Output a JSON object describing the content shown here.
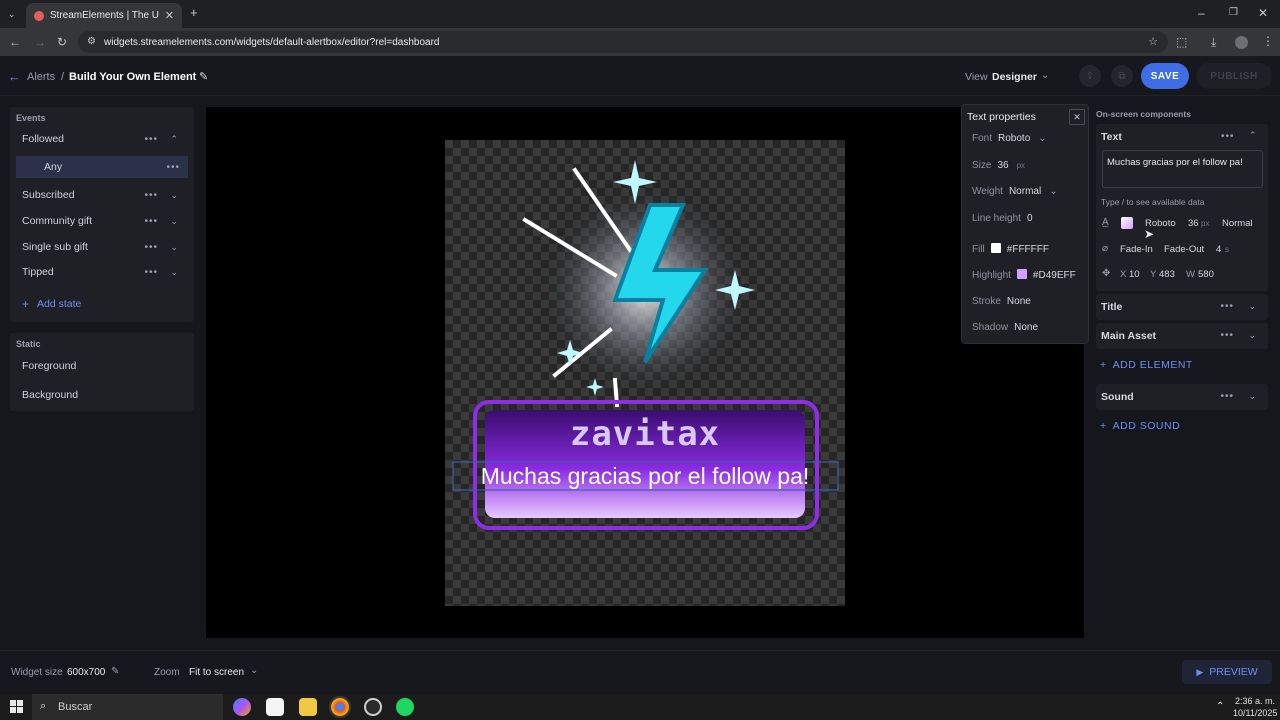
{
  "browser": {
    "tab_title": "StreamElements | The Ultimate",
    "url": "widgets.streamelements.com/widgets/default-alertbox/editor?rel=dashboard"
  },
  "header": {
    "breadcrumb_root": "Alerts",
    "breadcrumb_sep": "/",
    "page_title": "Build Your Own Element",
    "view_label": "View",
    "view_value": "Designer",
    "save_label": "SAVE",
    "publish_label": "PUBLISH"
  },
  "events": {
    "section_title": "Events",
    "items": [
      {
        "label": "Followed"
      },
      {
        "label": "Any"
      },
      {
        "label": "Subscribed"
      },
      {
        "label": "Community gift"
      },
      {
        "label": "Single sub gift"
      },
      {
        "label": "Tipped"
      }
    ],
    "add_state": "Add state"
  },
  "static": {
    "section_title": "Static",
    "items": [
      {
        "label": "Foreground"
      },
      {
        "label": "Background"
      }
    ]
  },
  "canvas": {
    "username": "zavitax",
    "message": "Muchas gracias por el follow pa!"
  },
  "text_properties": {
    "title": "Text properties",
    "font_label": "Font",
    "font_value": "Roboto",
    "size_label": "Size",
    "size_value": "36",
    "size_unit": "px",
    "weight_label": "Weight",
    "weight_value": "Normal",
    "lineheight_label": "Line height",
    "lineheight_value": "0",
    "fill_label": "Fill",
    "fill_value": "#FFFFFF",
    "highlight_label": "Highlight",
    "highlight_value": "#D49EFF",
    "stroke_label": "Stroke",
    "stroke_value": "None",
    "shadow_label": "Shadow",
    "shadow_value": "None"
  },
  "components": {
    "section_title": "On-screen components",
    "text": {
      "label": "Text",
      "value": "Muchas gracias por el follow pa!",
      "hint": "Type / to see available data",
      "font": "Roboto",
      "size": "36",
      "size_unit": "px",
      "weight": "Normal",
      "anim_in": "Fade-In",
      "anim_out": "Fade-Out",
      "duration": "4",
      "duration_unit": "s",
      "x_label": "X",
      "x": "10",
      "y_label": "Y",
      "y": "483",
      "w_label": "W",
      "w": "580"
    },
    "title_label": "Title",
    "main_asset_label": "Main Asset",
    "add_element": "ADD ELEMENT",
    "sound_label": "Sound",
    "add_sound": "ADD SOUND"
  },
  "footer": {
    "widget_size_label": "Widget size",
    "widget_size_value": "600x700",
    "zoom_label": "Zoom",
    "zoom_value": "Fit to screen",
    "preview_label": "PREVIEW"
  },
  "taskbar": {
    "search_placeholder": "Buscar",
    "time": "2:36 a. m.",
    "date": "10/11/2025"
  },
  "colors": {
    "accent": "#3f6de6",
    "fill": "#FFFFFF",
    "highlight": "#D49EFF"
  }
}
